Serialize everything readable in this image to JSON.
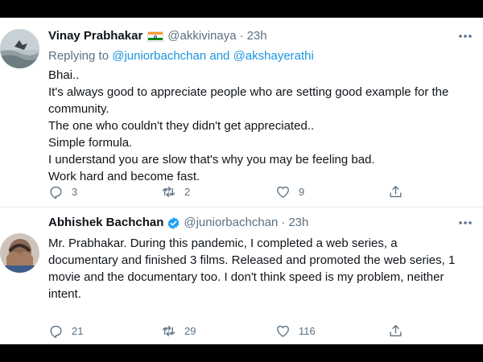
{
  "colors": {
    "link": "#1b95e0",
    "secondary": "#5b7083",
    "text": "#0f1419",
    "verified": "#1da1f2"
  },
  "tweets": [
    {
      "name": "Vinay Prabhakar",
      "flag_icon": "india-flag-icon",
      "handle": "@akkivinaya",
      "separator": "·",
      "time": "23h",
      "replying_prefix": "Replying to ",
      "replying_to_1": "@juniorbachchan",
      "replying_and": " and ",
      "replying_to_2": "@akshayerathi",
      "lines": [
        "Bhai..",
        "It's always good to appreciate people who are setting good example for the",
        "community.",
        "The one who couldn't they didn't get appreciated..",
        "Simple formula.",
        "I understand you are slow that's why you may be feeling bad.",
        "Work hard and become fast."
      ],
      "replies": "3",
      "retweets": "2",
      "likes": "9"
    },
    {
      "name": "Abhishek Bachchan",
      "verified_icon": "verified-badge-icon",
      "handle": "@juniorbachchan",
      "separator": "·",
      "time": "23h",
      "lines": [
        "Mr. Prabhakar. During this pandemic, I completed a web series, a",
        "documentary and finished 3 films. Released and promoted the web series, 1",
        "movie and the documentary too. I don't think speed is my problem, neither",
        "intent."
      ],
      "replies": "21",
      "retweets": "29",
      "likes": "116"
    }
  ]
}
